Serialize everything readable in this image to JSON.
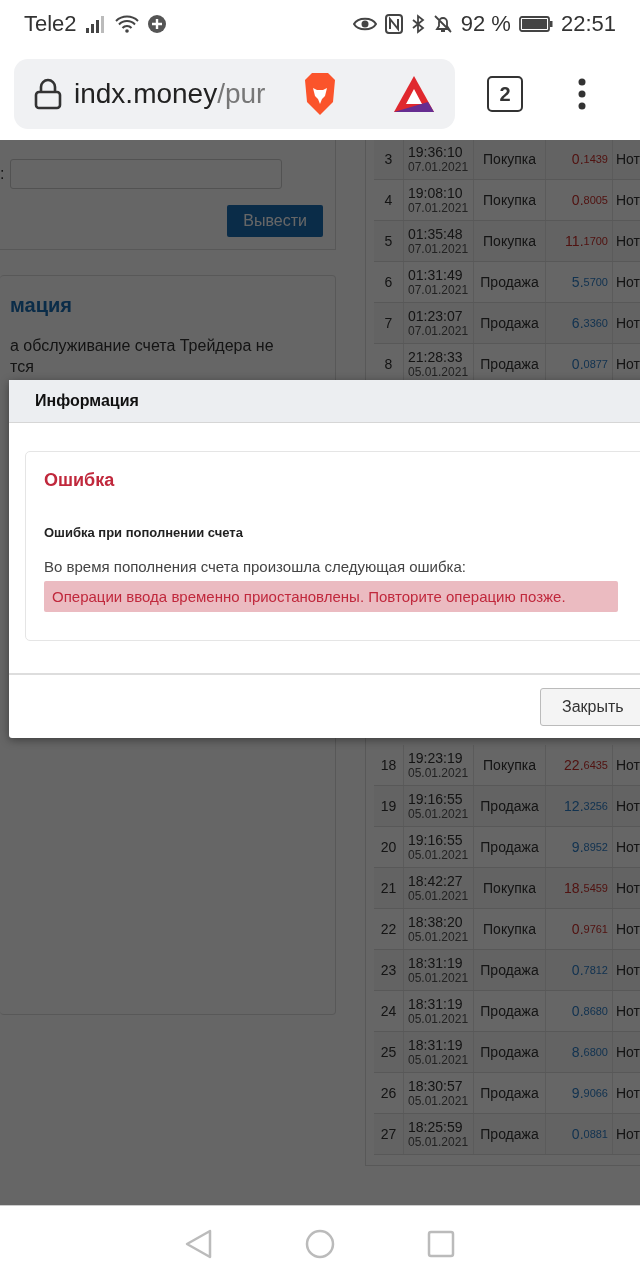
{
  "status_bar": {
    "carrier": "Tele2",
    "battery": "92 %",
    "time": "22:51"
  },
  "browser": {
    "url_host": "indx.money",
    "url_path": "/pur",
    "tab_count": "2"
  },
  "withdraw_form": {
    "field_label": ":",
    "button": "Вывести"
  },
  "info_card": {
    "title": "мация",
    "lines": [
      "а обслуживание счета Трейдера не",
      "тся"
    ]
  },
  "trades_table": {
    "rows_top": [
      {
        "num": "3",
        "time": "19:36:10",
        "date": "07.01.2021",
        "type": "Покупка",
        "kind": "buy",
        "amount": "0.1439",
        "column_5": "Нот"
      },
      {
        "num": "4",
        "time": "19:08:10",
        "date": "07.01.2021",
        "type": "Покупка",
        "kind": "buy",
        "amount": "0.8005",
        "column_5": "Нот"
      },
      {
        "num": "5",
        "time": "01:35:48",
        "date": "07.01.2021",
        "type": "Покупка",
        "kind": "buy",
        "amount": "11.1700",
        "column_5": "Нот"
      },
      {
        "num": "6",
        "time": "01:31:49",
        "date": "07.01.2021",
        "type": "Продажа",
        "kind": "sell",
        "amount": "5.5700",
        "column_5": "Нот"
      },
      {
        "num": "7",
        "time": "01:23:07",
        "date": "07.01.2021",
        "type": "Продажа",
        "kind": "sell",
        "amount": "6.3360",
        "column_5": "Нот"
      },
      {
        "num": "8",
        "time": "21:28:33",
        "date": "05.01.2021",
        "type": "Продажа",
        "kind": "sell",
        "amount": "0.0877",
        "column_5": "Нот"
      }
    ],
    "rows_bottom": [
      {
        "num": "18",
        "time": "19:23:19",
        "date": "05.01.2021",
        "type": "Покупка",
        "kind": "buy",
        "amount": "22.6435",
        "column_5": "Нот"
      },
      {
        "num": "19",
        "time": "19:16:55",
        "date": "05.01.2021",
        "type": "Продажа",
        "kind": "sell",
        "amount": "12.3256",
        "column_5": "Нот"
      },
      {
        "num": "20",
        "time": "19:16:55",
        "date": "05.01.2021",
        "type": "Продажа",
        "kind": "sell",
        "amount": "9.8952",
        "column_5": "Нот"
      },
      {
        "num": "21",
        "time": "18:42:27",
        "date": "05.01.2021",
        "type": "Покупка",
        "kind": "buy",
        "amount": "18.5459",
        "column_5": "Нот"
      },
      {
        "num": "22",
        "time": "18:38:20",
        "date": "05.01.2021",
        "type": "Покупка",
        "kind": "buy",
        "amount": "0.9761",
        "column_5": "Нот"
      },
      {
        "num": "23",
        "time": "18:31:19",
        "date": "05.01.2021",
        "type": "Продажа",
        "kind": "sell",
        "amount": "0.7812",
        "column_5": "Нот"
      },
      {
        "num": "24",
        "time": "18:31:19",
        "date": "05.01.2021",
        "type": "Продажа",
        "kind": "sell",
        "amount": "0.8680",
        "column_5": "Нот"
      },
      {
        "num": "25",
        "time": "18:31:19",
        "date": "05.01.2021",
        "type": "Продажа",
        "kind": "sell",
        "amount": "8.6800",
        "column_5": "Нот"
      },
      {
        "num": "26",
        "time": "18:30:57",
        "date": "05.01.2021",
        "type": "Продажа",
        "kind": "sell",
        "amount": "9.9066",
        "column_5": "Нот"
      },
      {
        "num": "27",
        "time": "18:25:59",
        "date": "05.01.2021",
        "type": "Продажа",
        "kind": "sell",
        "amount": "0.0881",
        "column_5": "Нот"
      }
    ]
  },
  "modal": {
    "title": "Информация",
    "error_title": "Ошибка",
    "subtitle": "Ошибка при пополнении счета",
    "message": "Во время пополнения счета произошла следующая ошибка:",
    "alert": "Операции ввода временно приостановлены. Повторите операцию позже.",
    "close_button": "Закрыть"
  }
}
